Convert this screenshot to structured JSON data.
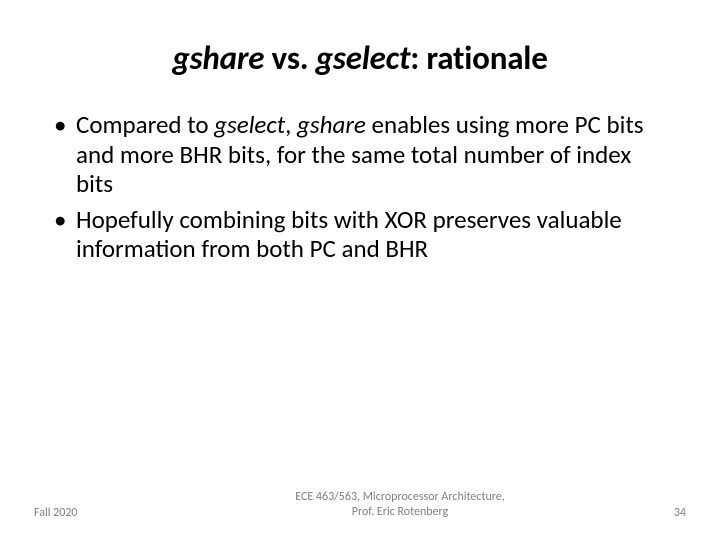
{
  "title": {
    "part1": "gshare",
    "sep1": " vs. ",
    "part2": "gselect",
    "tail": ": rationale"
  },
  "bullets": [
    {
      "pre": "Compared to ",
      "em1": "gselect",
      "mid": ", ",
      "em2": "gshare",
      "post": " enables using more PC bits and more BHR bits, for the same total number of index bits"
    },
    {
      "pre": "Hopefully combining bits with XOR preserves valuable information from both PC and BHR",
      "em1": "",
      "mid": "",
      "em2": "",
      "post": ""
    }
  ],
  "footer": {
    "left": "Fall 2020",
    "center_line1": "ECE 463/563, Microprocessor Architecture,",
    "center_line2": "Prof. Eric Rotenberg",
    "page": "34"
  }
}
